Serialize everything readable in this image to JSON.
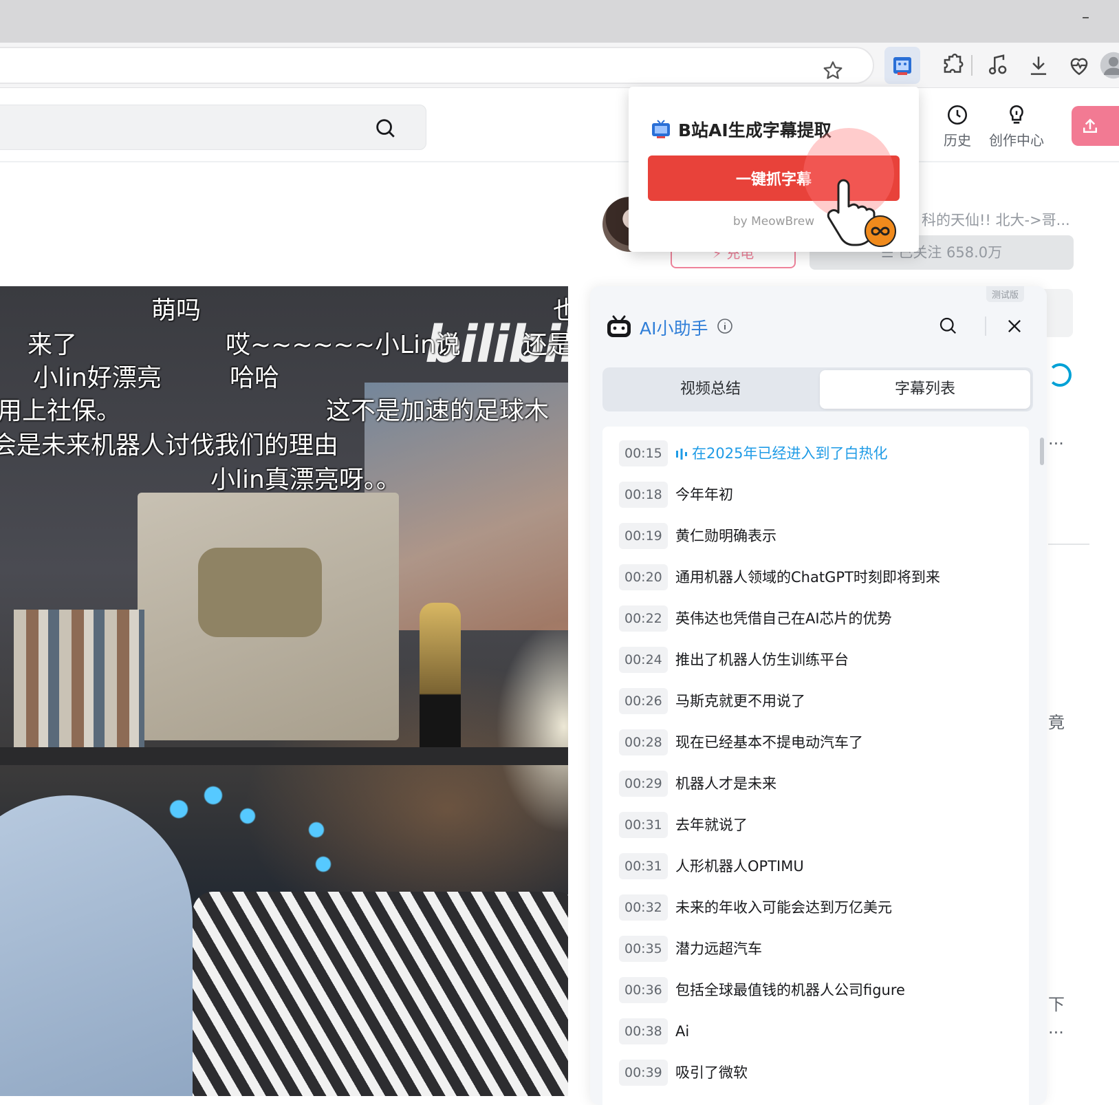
{
  "browser": {
    "minimize_glyph": "–"
  },
  "header": {
    "history_label": "历史",
    "creator_label": "创作中心"
  },
  "author": {
    "desc_fragment": "科的天仙!! 北大->哥...",
    "charge_label": "⚡ 充电",
    "follow_label": "☰ 已关注 658.0万"
  },
  "video": {
    "logo_text": "bilibili",
    "danmaku": [
      "萌吗",
      "来了",
      "哎~~~~~~小Lin说",
      "还是",
      "小lin好漂亮",
      "哈哈",
      "用上社保。",
      "这不是加速的足球木",
      "会是未来机器人讨伐我们的理由",
      "小lin真漂亮呀。。",
      "也"
    ]
  },
  "popup": {
    "title": "B站AI生成字幕提取",
    "grab_button": "一键抓字幕",
    "byline": "by MeowBrew"
  },
  "ai_panel": {
    "beta_badge": "测试版",
    "title": "AI小助手",
    "tabs": [
      {
        "label": "视频总结"
      },
      {
        "label": "字幕列表"
      }
    ],
    "subtitles": [
      {
        "time": "00:15",
        "text": "在2025年已经进入到了白热化"
      },
      {
        "time": "00:18",
        "text": "今年年初"
      },
      {
        "time": "00:19",
        "text": "黄仁勋明确表示"
      },
      {
        "time": "00:20",
        "text": "通用机器人领域的ChatGPT时刻即将到来"
      },
      {
        "time": "00:22",
        "text": "英伟达也凭借自己在AI芯片的优势"
      },
      {
        "time": "00:24",
        "text": "推出了机器人仿生训练平台"
      },
      {
        "time": "00:26",
        "text": "马斯克就更不用说了"
      },
      {
        "time": "00:28",
        "text": "现在已经基本不提电动汽车了"
      },
      {
        "time": "00:29",
        "text": "机器人才是未来"
      },
      {
        "time": "00:31",
        "text": "去年就说了"
      },
      {
        "time": "00:31",
        "text": "人形机器人OPTIMU"
      },
      {
        "time": "00:32",
        "text": "未来的年收入可能会达到万亿美元"
      },
      {
        "time": "00:35",
        "text": "潜力远超汽车"
      },
      {
        "time": "00:36",
        "text": "包括全球最值钱的机器人公司figure"
      },
      {
        "time": "00:38",
        "text": "Ai"
      },
      {
        "time": "00:39",
        "text": "吸引了微软"
      }
    ]
  },
  "right_column": {
    "frag_dots_1": "...",
    "frag_jing": "竟",
    "frag_xia": "下",
    "frag_dots_2": "..."
  },
  "colors": {
    "accent_blue": "#2f7ed8",
    "active_sub": "#1e9be6",
    "grab_red": "#e8423a",
    "bili_pink": "#f27a93"
  }
}
